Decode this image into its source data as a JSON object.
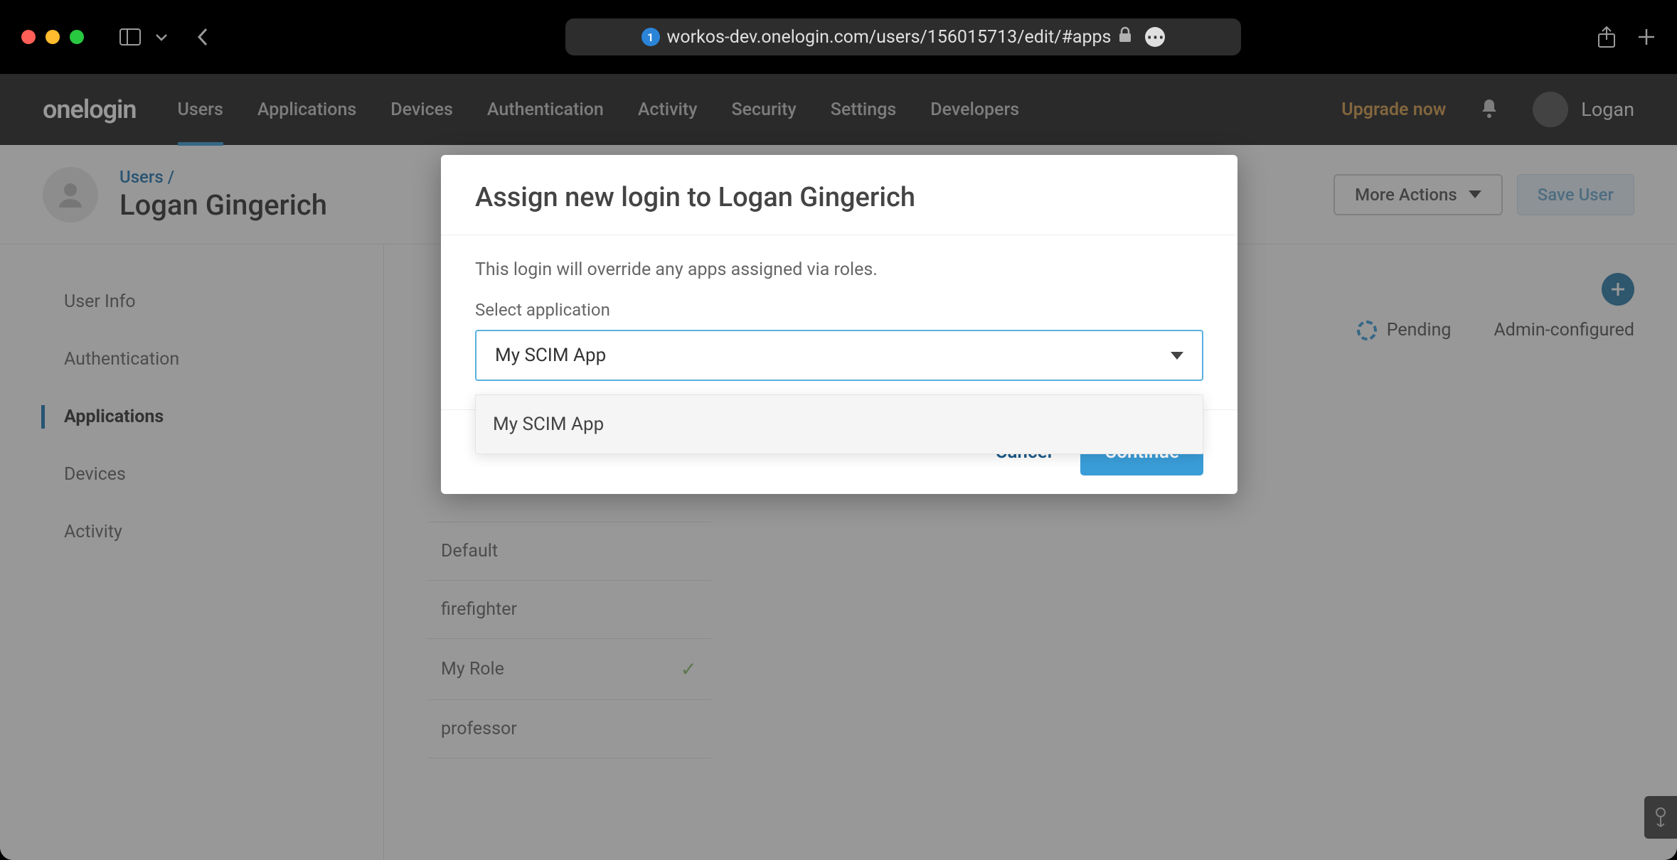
{
  "browser": {
    "url": "workos-dev.onelogin.com/users/156015713/edit/#apps",
    "tab_count_badge": "1"
  },
  "topnav": {
    "brand": "onelogin",
    "items": [
      "Users",
      "Applications",
      "Devices",
      "Authentication",
      "Activity",
      "Security",
      "Settings",
      "Developers"
    ],
    "active_index": 0,
    "upgrade": "Upgrade now",
    "user_name": "Logan"
  },
  "page_header": {
    "breadcrumb_root": "Users",
    "breadcrumb_sep": "/",
    "title": "Logan Gingerich",
    "more_actions": "More Actions",
    "save": "Save User"
  },
  "sidebar": {
    "items": [
      "User Info",
      "Authentication",
      "Applications",
      "Devices",
      "Activity"
    ],
    "active_index": 2
  },
  "main": {
    "status_pending": "Pending",
    "status_admin": "Admin-configured",
    "roles": [
      {
        "name": "Default",
        "checked": false
      },
      {
        "name": "firefighter",
        "checked": false
      },
      {
        "name": "My Role",
        "checked": true
      },
      {
        "name": "professor",
        "checked": false
      }
    ]
  },
  "modal": {
    "title": "Assign new login to Logan Gingerich",
    "description": "This login will override any apps assigned via roles.",
    "select_label": "Select application",
    "selected_value": "My SCIM App",
    "options": [
      "My SCIM App"
    ],
    "cancel": "Cancel",
    "continue": "Continue"
  }
}
